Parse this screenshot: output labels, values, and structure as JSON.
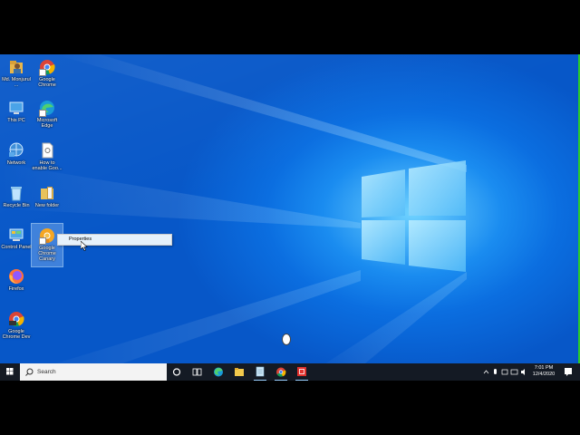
{
  "desktop": {
    "icons": [
      {
        "label": "Md. Monjurul ...",
        "icon": "user-folder-icon"
      },
      {
        "label": "Google Chrome",
        "icon": "chrome-icon"
      },
      {
        "label": "This PC",
        "icon": "this-pc-icon"
      },
      {
        "label": "Microsoft Edge",
        "icon": "edge-icon"
      },
      {
        "label": "Network",
        "icon": "network-icon"
      },
      {
        "label": "How to enable Goo...",
        "icon": "document-icon"
      },
      {
        "label": "Recycle Bin",
        "icon": "recycle-bin-icon"
      },
      {
        "label": "New folder",
        "icon": "folder-icon"
      },
      {
        "label": "Control Panel",
        "icon": "control-panel-icon"
      },
      {
        "label": "Google Chrome Canary",
        "icon": "chrome-canary-icon"
      },
      {
        "label": "Firefox",
        "icon": "firefox-icon"
      },
      {
        "label": "Google Chrome Dev",
        "icon": "chrome-dev-icon"
      }
    ]
  },
  "context_menu": {
    "items": [
      {
        "label": "Properties"
      }
    ]
  },
  "taskbar": {
    "search_placeholder": "Search",
    "apps": [
      "cortana-icon",
      "task-view-icon",
      "edge-icon",
      "file-explorer-icon",
      "notepad-icon",
      "chrome-icon",
      "recorder-icon"
    ],
    "clock_time": "7:01 PM",
    "clock_date": "12/4/2020"
  },
  "colors": {
    "accent": "#0b6ee0",
    "taskbar": "#141a24"
  }
}
